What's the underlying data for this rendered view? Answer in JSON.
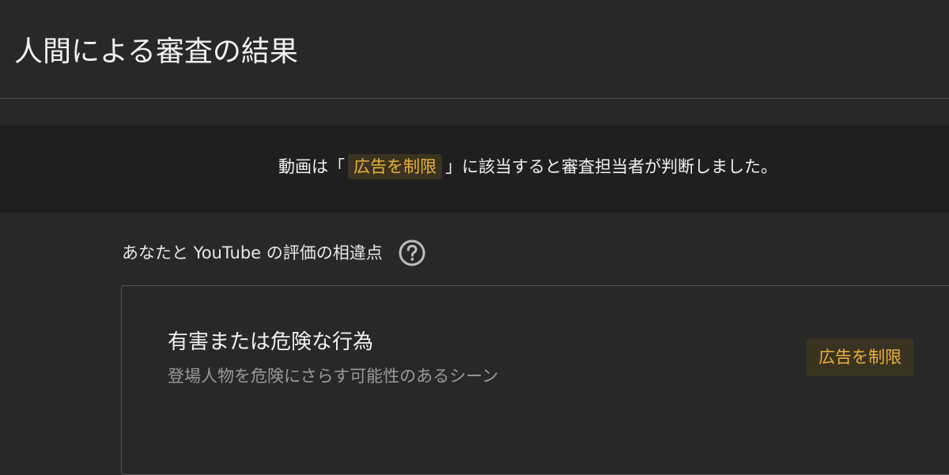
{
  "header": {
    "title": "人間による審査の結果"
  },
  "verdict": {
    "prefix": "動画は「",
    "label": "広告を制限",
    "suffix": "」に該当すると審査担当者が判断しました。"
  },
  "discrepancy": {
    "heading": "あなたと YouTube の評価の相違点"
  },
  "card": {
    "title": "有害または危険な行為",
    "description": "登場人物を危険にさらす可能性のあるシーン",
    "rating": "広告を制限"
  },
  "colors": {
    "background": "#282828",
    "banner": "#1f1f1f",
    "accent": "#e8b23a",
    "chip_bg": "#3b3321"
  }
}
